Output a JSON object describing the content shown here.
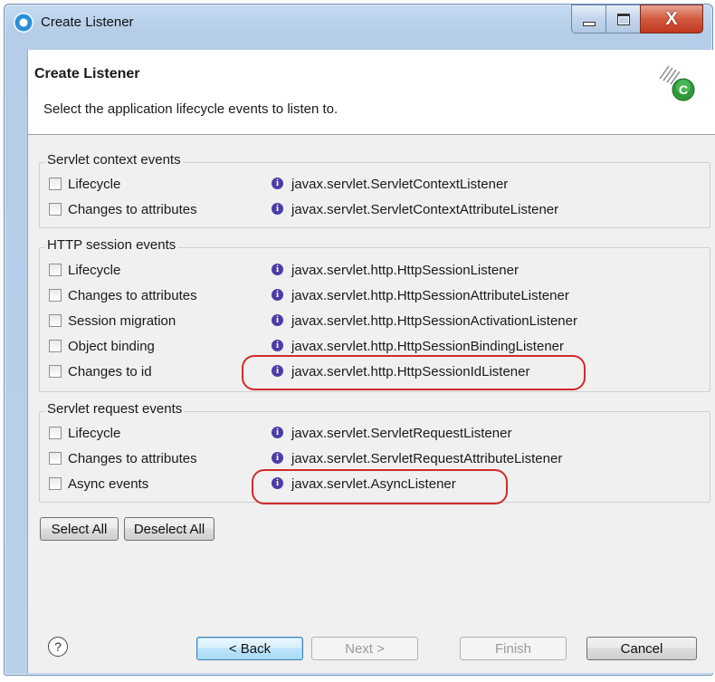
{
  "window": {
    "title": "Create Listener",
    "controls": {
      "minimize": "",
      "maximize": "",
      "close": "X"
    }
  },
  "header": {
    "title": "Create Listener",
    "description": "Select the application lifecycle events to listen to."
  },
  "groups": [
    {
      "title": "Servlet context events",
      "items": [
        {
          "label": "Lifecycle",
          "interface": "javax.servlet.ServletContextListener",
          "checked": false
        },
        {
          "label": "Changes to attributes",
          "interface": "javax.servlet.ServletContextAttributeListener",
          "checked": false
        }
      ]
    },
    {
      "title": "HTTP session events",
      "items": [
        {
          "label": "Lifecycle",
          "interface": "javax.servlet.http.HttpSessionListener",
          "checked": false
        },
        {
          "label": "Changes to attributes",
          "interface": "javax.servlet.http.HttpSessionAttributeListener",
          "checked": false
        },
        {
          "label": "Session migration",
          "interface": "javax.servlet.http.HttpSessionActivationListener",
          "checked": false
        },
        {
          "label": "Object binding",
          "interface": "javax.servlet.http.HttpSessionBindingListener",
          "checked": false
        },
        {
          "label": "Changes to id",
          "interface": "javax.servlet.http.HttpSessionIdListener",
          "checked": false
        }
      ]
    },
    {
      "title": "Servlet request events",
      "items": [
        {
          "label": "Lifecycle",
          "interface": "javax.servlet.ServletRequestListener",
          "checked": false
        },
        {
          "label": "Changes to attributes",
          "interface": "javax.servlet.ServletRequestAttributeListener",
          "checked": false
        },
        {
          "label": "Async events",
          "interface": "javax.servlet.AsyncListener",
          "checked": false
        }
      ]
    }
  ],
  "selection_buttons": {
    "select_all": "Select All",
    "deselect_all": "Deselect All"
  },
  "footer": {
    "help": "?",
    "back": "< Back",
    "next": "Next >",
    "finish": "Finish",
    "cancel": "Cancel"
  },
  "icons": {
    "info": "i",
    "wizard_badge": "C"
  },
  "colors": {
    "highlight": "#d22a2a",
    "info_icon": "#4a3da8",
    "title_bar": "#b9d0ea"
  }
}
